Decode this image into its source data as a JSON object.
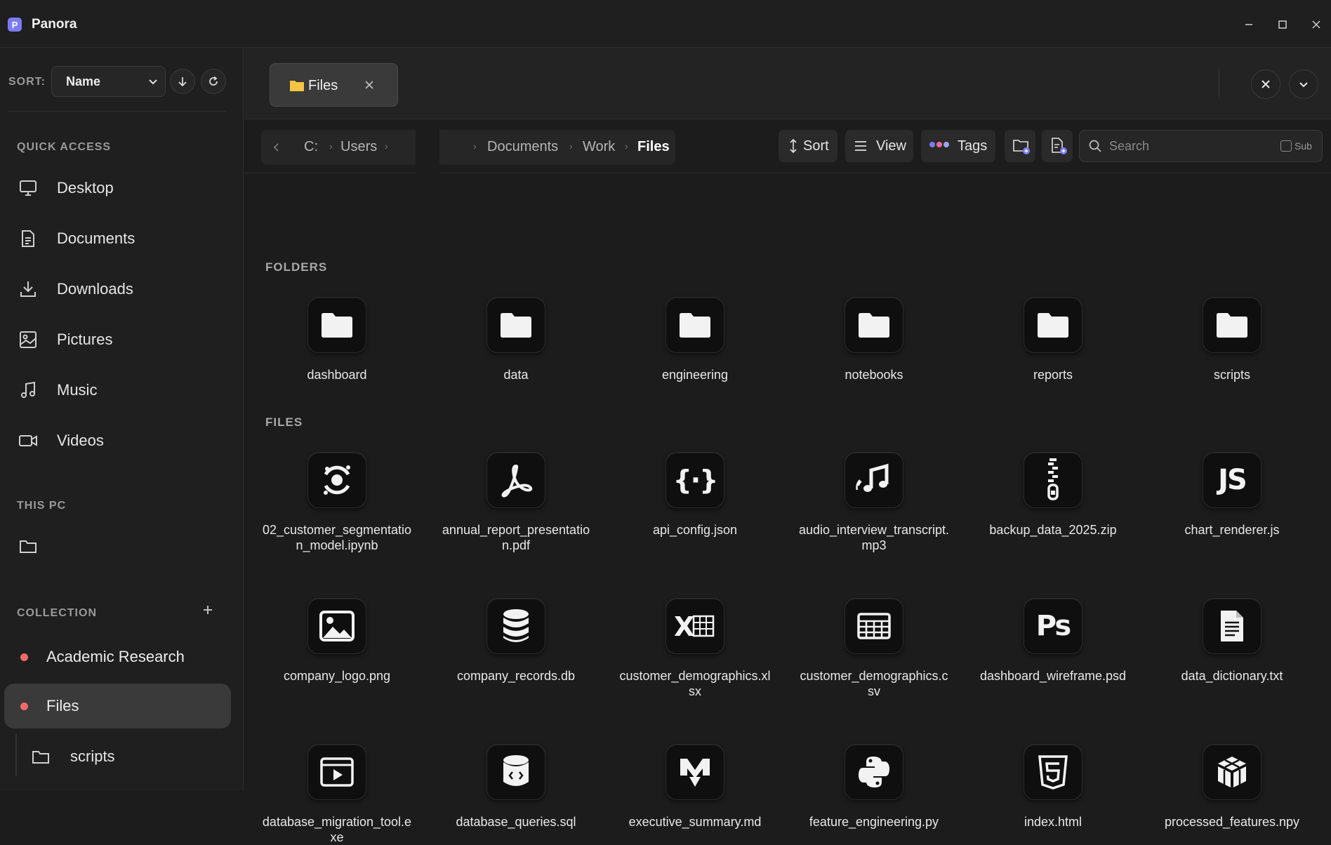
{
  "app": {
    "title": "Panora",
    "logo_letter": "P"
  },
  "sidebar": {
    "sort_label": "SORT:",
    "sort_value": "Name",
    "quick_access_title": "QUICK ACCESS",
    "quick_access": [
      {
        "label": "Desktop",
        "icon": "monitor-icon"
      },
      {
        "label": "Documents",
        "icon": "document-icon"
      },
      {
        "label": "Downloads",
        "icon": "download-icon"
      },
      {
        "label": "Pictures",
        "icon": "image-icon"
      },
      {
        "label": "Music",
        "icon": "music-icon"
      },
      {
        "label": "Videos",
        "icon": "video-icon"
      }
    ],
    "this_pc_title": "THIS PC",
    "collection_title": "COLLECTION",
    "collections": [
      {
        "label": "Academic Research",
        "color": "#ef6a6a",
        "active": false
      },
      {
        "label": "Files",
        "color": "#ef6a6a",
        "active": true
      }
    ],
    "collection_child": {
      "label": "scripts"
    }
  },
  "tabs": [
    {
      "label": "Files"
    }
  ],
  "breadcrumb": [
    "C:",
    "Users",
    "Documents",
    "Work",
    "Files"
  ],
  "toolbar": {
    "sort_label": "Sort",
    "view_label": "View",
    "tags_label": "Tags",
    "search_placeholder": "Search",
    "sub_label": "Sub"
  },
  "folders_title": "FOLDERS",
  "folders": [
    "dashboard",
    "data",
    "engineering",
    "notebooks",
    "reports",
    "scripts"
  ],
  "files_title": "FILES",
  "files": [
    {
      "name": "02_customer_segmentation_model.ipynb",
      "icon": "jupyter-icon"
    },
    {
      "name": "annual_report_presentation.pdf",
      "icon": "pdf-icon"
    },
    {
      "name": "api_config.json",
      "icon": "json-icon"
    },
    {
      "name": "audio_interview_transcript.mp3",
      "icon": "audio-icon"
    },
    {
      "name": "backup_data_2025.zip",
      "icon": "zip-icon"
    },
    {
      "name": "chart_renderer.js",
      "icon": "js-icon"
    },
    {
      "name": "company_logo.png",
      "icon": "image-icon"
    },
    {
      "name": "company_records.db",
      "icon": "database-icon"
    },
    {
      "name": "customer_demographics.xlsx",
      "icon": "excel-icon"
    },
    {
      "name": "customer_demographics.csv",
      "icon": "table-icon"
    },
    {
      "name": "dashboard_wireframe.psd",
      "icon": "photoshop-icon"
    },
    {
      "name": "data_dictionary.txt",
      "icon": "text-file-icon"
    },
    {
      "name": "database_migration_tool.exe",
      "icon": "executable-icon"
    },
    {
      "name": "database_queries.sql",
      "icon": "sql-icon"
    },
    {
      "name": "executive_summary.md",
      "icon": "markdown-icon"
    },
    {
      "name": "feature_engineering.py",
      "icon": "python-icon"
    },
    {
      "name": "index.html",
      "icon": "html-icon"
    },
    {
      "name": "processed_features.npy",
      "icon": "numpy-icon"
    }
  ],
  "colors": {
    "accent": "#7b7cf5",
    "collection_dot": "#ef6a6a",
    "folder_tab_icon": "#f5c542"
  }
}
